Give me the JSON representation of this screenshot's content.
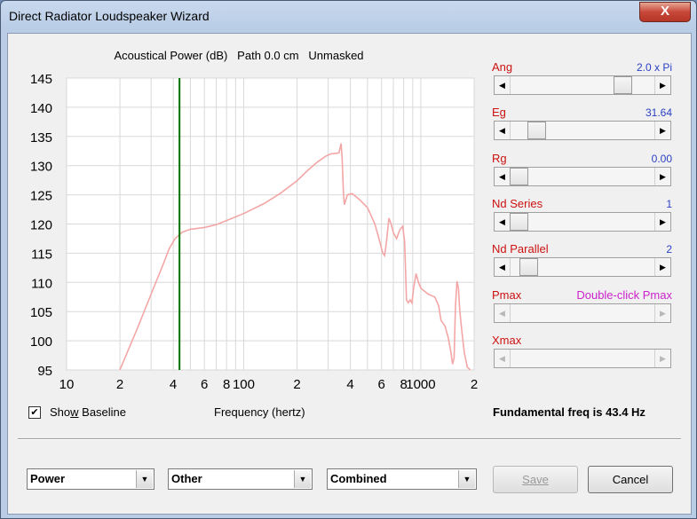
{
  "window": {
    "title": "Direct Radiator Loudspeaker Wizard",
    "close_glyph": "X"
  },
  "chart": {
    "title": "Acoustical Power (dB)   Path 0.0 cm   Unmasked",
    "xlabel": "Frequency (hertz)"
  },
  "chart_data": {
    "type": "line",
    "title": "Acoustical Power (dB)   Path 0.0 cm   Unmasked",
    "xlabel": "Frequency (hertz)",
    "ylabel": "",
    "xscale": "log",
    "xlim": [
      10,
      2000
    ],
    "ylim": [
      95,
      145
    ],
    "yticks": [
      145,
      140,
      135,
      130,
      125,
      120,
      115,
      110,
      105,
      100,
      95
    ],
    "xtick_labels": [
      "10",
      "2",
      "4",
      "6",
      "8",
      "100",
      "2",
      "4",
      "6",
      "8",
      "1000",
      "2"
    ],
    "xtick_values": [
      10,
      20,
      40,
      60,
      80,
      100,
      200,
      400,
      600,
      800,
      1000,
      2000
    ],
    "grid": true,
    "series": [
      {
        "color": "#f4a6a6",
        "points": [
          [
            20,
            95
          ],
          [
            25,
            102
          ],
          [
            30,
            108
          ],
          [
            35,
            113
          ],
          [
            38,
            115.8
          ],
          [
            41,
            117.5
          ],
          [
            45,
            118.6
          ],
          [
            50,
            119.1
          ],
          [
            60,
            119.4
          ],
          [
            70,
            119.9
          ],
          [
            80,
            120.6
          ],
          [
            100,
            121.8
          ],
          [
            130,
            123.5
          ],
          [
            160,
            125.2
          ],
          [
            200,
            127.4
          ],
          [
            230,
            129.2
          ],
          [
            260,
            130.6
          ],
          [
            290,
            131.6
          ],
          [
            310,
            132
          ],
          [
            330,
            132.1
          ],
          [
            345,
            132.2
          ],
          [
            355,
            133.8
          ],
          [
            360,
            131
          ],
          [
            365,
            126
          ],
          [
            370,
            123.3
          ],
          [
            385,
            125
          ],
          [
            410,
            125.2
          ],
          [
            450,
            124.2
          ],
          [
            500,
            122.8
          ],
          [
            550,
            120
          ],
          [
            580,
            117.5
          ],
          [
            610,
            115
          ],
          [
            625,
            114.6
          ],
          [
            640,
            117
          ],
          [
            660,
            121
          ],
          [
            680,
            120
          ],
          [
            700,
            118.5
          ],
          [
            730,
            117.5
          ],
          [
            760,
            119
          ],
          [
            790,
            119.6
          ],
          [
            810,
            117
          ],
          [
            820,
            112
          ],
          [
            830,
            107
          ],
          [
            850,
            106.5
          ],
          [
            870,
            107
          ],
          [
            890,
            106.5
          ],
          [
            910,
            109
          ],
          [
            940,
            111.5
          ],
          [
            970,
            110
          ],
          [
            1000,
            109
          ],
          [
            1100,
            108
          ],
          [
            1200,
            107.5
          ],
          [
            1260,
            106
          ],
          [
            1300,
            103.5
          ],
          [
            1370,
            102.5
          ],
          [
            1430,
            100.5
          ],
          [
            1480,
            98
          ],
          [
            1510,
            96
          ],
          [
            1540,
            97
          ],
          [
            1570,
            106
          ],
          [
            1600,
            110.2
          ],
          [
            1630,
            109
          ],
          [
            1660,
            105
          ],
          [
            1700,
            102
          ],
          [
            1760,
            98
          ],
          [
            1830,
            95.5
          ],
          [
            1900,
            95
          ]
        ]
      }
    ],
    "marker_line": {
      "x": 43.4,
      "color": "#007000"
    }
  },
  "show_baseline": {
    "label": "Show Baseline",
    "hotkey": "w",
    "checked": true,
    "check_glyph": "✔"
  },
  "fundamental": {
    "text": "Fundamental freq is 43.4 Hz",
    "color": "#007000"
  },
  "params": [
    {
      "label": "Ang",
      "value": "2.0 x Pi",
      "thumb": 0.82,
      "enabled": true
    },
    {
      "label": "Eg",
      "value": "31.64",
      "thumb": 0.14,
      "enabled": true
    },
    {
      "label": "Rg",
      "value": "0.00",
      "thumb": 0.0,
      "enabled": true
    },
    {
      "label": "Nd  Series",
      "value": "1",
      "thumb": 0.0,
      "enabled": true
    },
    {
      "label": "Nd  Parallel",
      "value": "2",
      "thumb": 0.08,
      "enabled": true
    },
    {
      "label": "Pmax",
      "value": "Double-click Pmax",
      "thumb": null,
      "enabled": false
    },
    {
      "label": "Xmax",
      "value": "",
      "thumb": null,
      "enabled": false
    }
  ],
  "arrows": {
    "left": "◀",
    "right": "▶"
  },
  "dropdowns": [
    {
      "value": "Power",
      "arrow": "▼"
    },
    {
      "value": "Other",
      "arrow": "▼"
    },
    {
      "value": "Combined",
      "arrow": "▼"
    }
  ],
  "buttons": {
    "save": "Save",
    "cancel": "Cancel"
  }
}
